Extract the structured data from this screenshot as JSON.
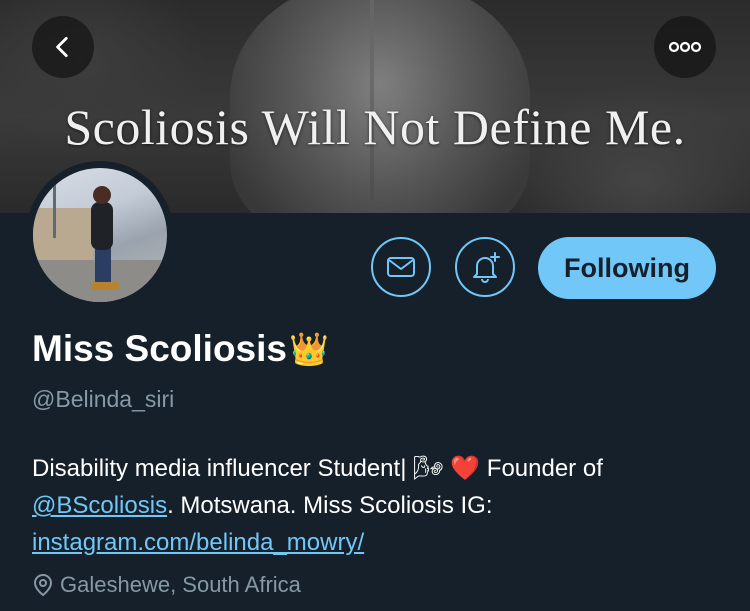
{
  "banner": {
    "text": "Scoliosis Will Not Define Me."
  },
  "header": {
    "back_icon": "chevron-left-icon",
    "more_icon": "more-horizontal-icon"
  },
  "actions": {
    "mail_icon": "mail-icon",
    "notify_icon": "bell-plus-icon",
    "following_label": "Following"
  },
  "profile": {
    "display_name": "Miss Scoliosis",
    "name_emoji": "👑",
    "handle": "@Belinda_siri",
    "bio": {
      "part1": "Disability media influencer Student| 🌬 ❤️ Founder of ",
      "mention": "@BScoliosis",
      "part2": ". Motswana. Miss Scoliosis IG: ",
      "link": "instagram.com/belinda_mowry/"
    },
    "location": "Galeshewe, South Africa"
  },
  "colors": {
    "accent": "#71c7f8",
    "background": "#15202b",
    "secondary_text": "#8899a6"
  }
}
